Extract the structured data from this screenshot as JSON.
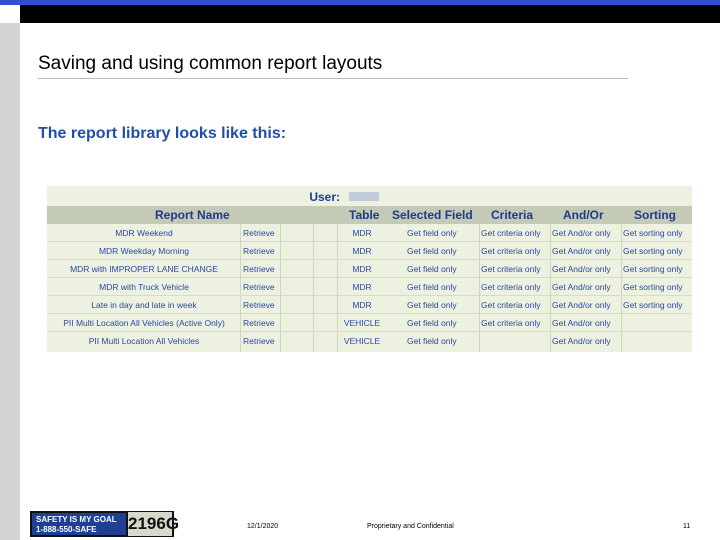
{
  "slide": {
    "title": "Saving and using common report layouts",
    "subtitle": "The report library looks like this:"
  },
  "report_library": {
    "user_label": "User:",
    "columns": {
      "report_name": "Report Name",
      "table": "Table",
      "selected_field": "Selected Field",
      "criteria": "Criteria",
      "and_or": "And/Or",
      "sorting": "Sorting"
    },
    "rows": [
      {
        "name": "MDR Weekend",
        "retrieve": "Retrieve",
        "table": "MDR",
        "field": "Get field only",
        "criteria": "Get criteria only",
        "andor": "Get And/or only",
        "sorting": "Get sorting only"
      },
      {
        "name": "MDR Weekday Morning",
        "retrieve": "Retrieve",
        "table": "MDR",
        "field": "Get field only",
        "criteria": "Get criteria only",
        "andor": "Get And/or only",
        "sorting": "Get sorting only"
      },
      {
        "name": "MDR with IMPROPER LANE CHANGE",
        "retrieve": "Retrieve",
        "table": "MDR",
        "field": "Get field only",
        "criteria": "Get criteria only",
        "andor": "Get And/or only",
        "sorting": "Get sorting only"
      },
      {
        "name": "MDR with Truck Vehicle",
        "retrieve": "Retrieve",
        "table": "MDR",
        "field": "Get field only",
        "criteria": "Get criteria only",
        "andor": "Get And/or only",
        "sorting": "Get sorting only"
      },
      {
        "name": "Late in day and late in week",
        "retrieve": "Retrieve",
        "table": "MDR",
        "field": "Get field only",
        "criteria": "Get criteria only",
        "andor": "Get And/or only",
        "sorting": "Get sorting only"
      },
      {
        "name": "PII Multi Location All Vehicles (Active Only)",
        "retrieve": "Retrieve",
        "table": "VEHICLE",
        "field": "Get field only",
        "criteria": "Get criteria only",
        "andor": "Get And/or only",
        "sorting": ""
      },
      {
        "name": "PII Multi Location All Vehicles",
        "retrieve": "Retrieve",
        "table": "VEHICLE",
        "field": "Get field only",
        "criteria": "",
        "andor": "Get And/or only",
        "sorting": ""
      }
    ]
  },
  "footer": {
    "logo_line1": "SAFETY IS MY GOAL",
    "logo_line2": "1-888-550-SAFE",
    "logo_code": "2196G",
    "date": "12/1/2020",
    "confidential": "Proprietary and Confidential",
    "page_number": "11"
  },
  "colors": {
    "top_bar_blue": "#2f4fd0",
    "top_bar_black": "#000000",
    "subtitle_blue": "#1f4fa8",
    "table_background": "#ecf1e0",
    "table_header": "#c3cbb7",
    "link_blue": "#2a47a8"
  }
}
